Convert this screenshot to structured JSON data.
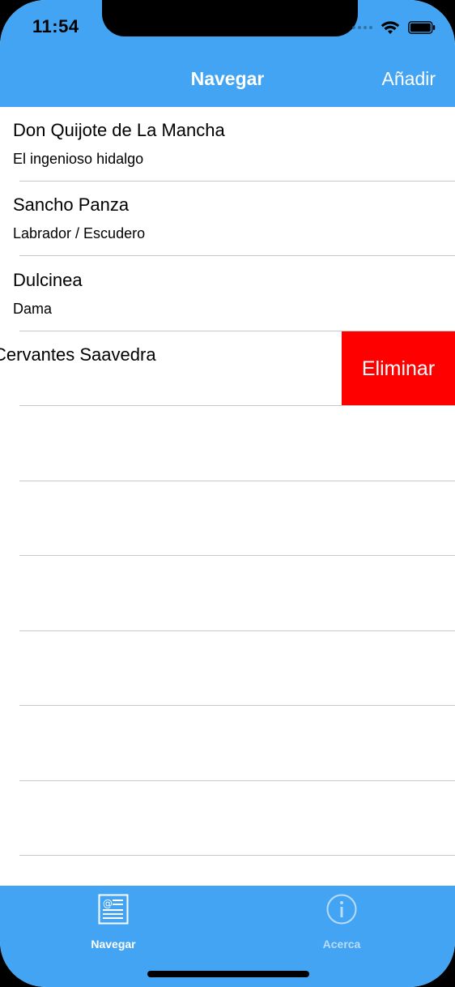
{
  "status_bar": {
    "time": "11:54"
  },
  "nav_bar": {
    "title": "Navegar",
    "add_label": "Añadir",
    "background": "#42a4f2"
  },
  "list": {
    "items": [
      {
        "title": "Don Quijote de La Mancha",
        "subtitle": "El ingenioso hidalgo"
      },
      {
        "title": "Sancho Panza",
        "subtitle": "Labrador / Escudero"
      },
      {
        "title": "Dulcinea",
        "subtitle": "Dama"
      },
      {
        "title": "Cervantes Saavedra",
        "subtitle": ""
      }
    ],
    "delete_label": "Eliminar",
    "delete_color": "#ff0000"
  },
  "tab_bar": {
    "tabs": [
      {
        "label": "Navegar",
        "icon": "newspaper-icon",
        "selected": true
      },
      {
        "label": "Acerca",
        "icon": "info-icon",
        "selected": false
      }
    ]
  }
}
